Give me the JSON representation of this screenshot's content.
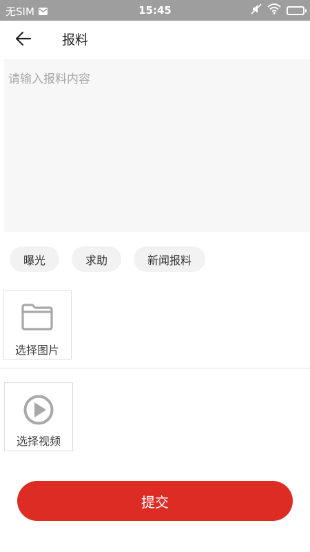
{
  "status_bar": {
    "carrier": "无SIM",
    "time": "15:45",
    "icons": [
      "mail-icon",
      "mute-icon",
      "wifi-icon",
      "battery-icon"
    ]
  },
  "header": {
    "back_icon": "arrow-left-icon",
    "title": "报料"
  },
  "report": {
    "placeholder": "请输入报料内容",
    "value": ""
  },
  "tags": [
    {
      "label": "曝光"
    },
    {
      "label": "求助"
    },
    {
      "label": "新闻报料"
    }
  ],
  "image_picker": {
    "icon": "folder-icon",
    "label": "选择图片"
  },
  "video_picker": {
    "icon": "play-circle-icon",
    "label": "选择视频"
  },
  "submit": {
    "label": "提交"
  },
  "colors": {
    "status_bar": "#9e9e9e",
    "accent": "#dd2c24",
    "input_bg": "#f7f7f7",
    "tag_bg": "#f2f2f2",
    "icon_gray": "#a8a8a8"
  }
}
